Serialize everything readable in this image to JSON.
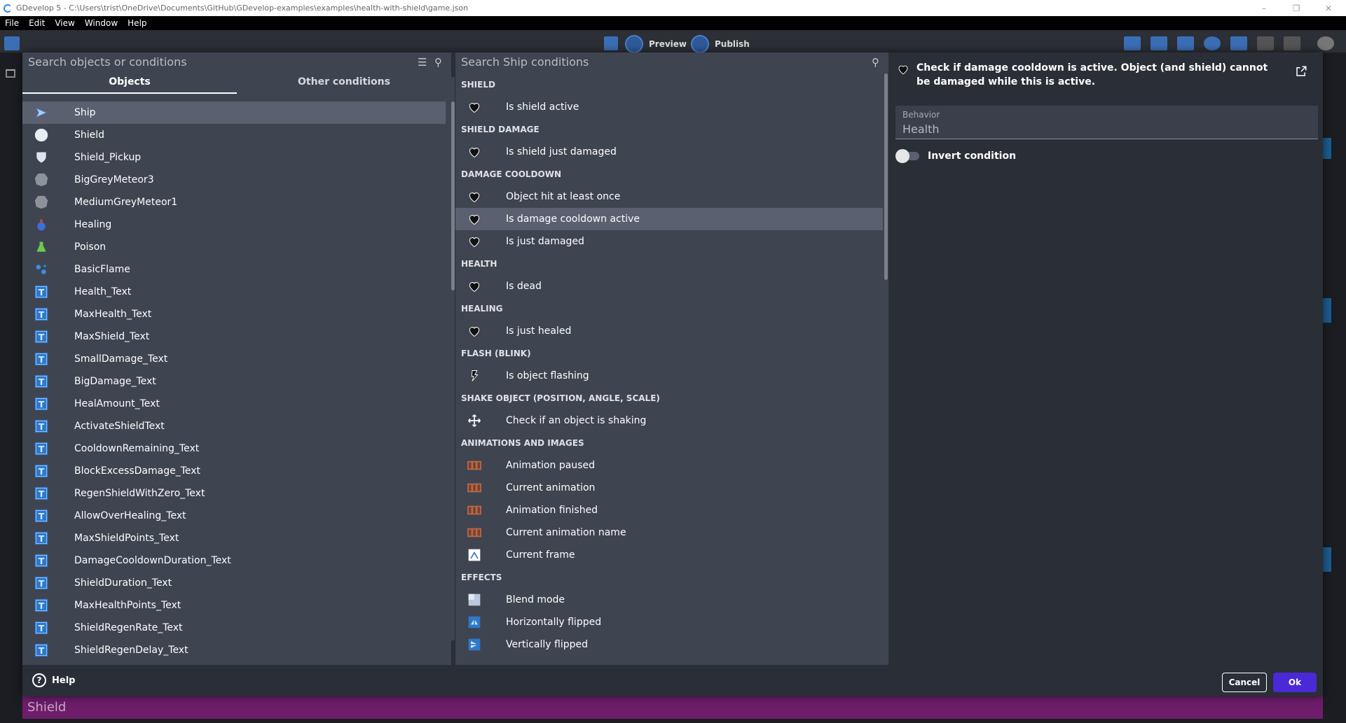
{
  "window": {
    "title": "GDevelop 5 - C:\\Users\\trist\\OneDrive\\Documents\\GitHub\\GDevelop-examples\\examples\\health-with-shield\\game.json",
    "controls": [
      "–",
      "❐",
      "✕"
    ]
  },
  "menubar": [
    "File",
    "Edit",
    "View",
    "Window",
    "Help"
  ],
  "toolbar": {
    "preview": "Preview",
    "publish": "Publish"
  },
  "objects_panel": {
    "search_placeholder": "Search objects or conditions",
    "tabs": [
      "Objects",
      "Other conditions"
    ],
    "selected": "Ship",
    "items": [
      {
        "name": "Ship",
        "icon": "ship-icon"
      },
      {
        "name": "Shield",
        "icon": "circle-icon"
      },
      {
        "name": "Shield_Pickup",
        "icon": "shield-icon"
      },
      {
        "name": "BigGreyMeteor3",
        "icon": "meteor-icon"
      },
      {
        "name": "MediumGreyMeteor1",
        "icon": "meteor-icon"
      },
      {
        "name": "Healing",
        "icon": "potion-blue-icon"
      },
      {
        "name": "Poison",
        "icon": "potion-green-icon"
      },
      {
        "name": "BasicFlame",
        "icon": "particles-icon"
      },
      {
        "name": "Health_Text",
        "icon": "text-object-icon"
      },
      {
        "name": "MaxHealth_Text",
        "icon": "text-object-icon"
      },
      {
        "name": "MaxShield_Text",
        "icon": "text-object-icon"
      },
      {
        "name": "SmallDamage_Text",
        "icon": "text-object-icon"
      },
      {
        "name": "BigDamage_Text",
        "icon": "text-object-icon"
      },
      {
        "name": "HealAmount_Text",
        "icon": "text-object-icon"
      },
      {
        "name": "ActivateShieldText",
        "icon": "text-object-icon"
      },
      {
        "name": "CooldownRemaining_Text",
        "icon": "text-object-icon"
      },
      {
        "name": "BlockExcessDamage_Text",
        "icon": "text-object-icon"
      },
      {
        "name": "RegenShieldWithZero_Text",
        "icon": "text-object-icon"
      },
      {
        "name": "AllowOverHealing_Text",
        "icon": "text-object-icon"
      },
      {
        "name": "MaxShieldPoints_Text",
        "icon": "text-object-icon"
      },
      {
        "name": "DamageCooldownDuration_Text",
        "icon": "text-object-icon"
      },
      {
        "name": "ShieldDuration_Text",
        "icon": "text-object-icon"
      },
      {
        "name": "MaxHealthPoints_Text",
        "icon": "text-object-icon"
      },
      {
        "name": "ShieldRegenRate_Text",
        "icon": "text-object-icon"
      },
      {
        "name": "ShieldRegenDelay_Text",
        "icon": "text-object-icon"
      }
    ]
  },
  "conditions_panel": {
    "search_placeholder": "Search Ship conditions",
    "selected": "Is damage cooldown active",
    "sections": [
      {
        "title": "SHIELD",
        "items": [
          {
            "label": "Is shield active",
            "icon": "heart-icon"
          }
        ]
      },
      {
        "title": "SHIELD DAMAGE",
        "items": [
          {
            "label": "Is shield just damaged",
            "icon": "heart-icon"
          }
        ]
      },
      {
        "title": "DAMAGE COOLDOWN",
        "items": [
          {
            "label": "Object hit at least once",
            "icon": "heart-icon"
          },
          {
            "label": "Is damage cooldown active",
            "icon": "heart-icon"
          },
          {
            "label": "Is just damaged",
            "icon": "heart-icon"
          }
        ]
      },
      {
        "title": "HEALTH",
        "items": [
          {
            "label": "Is dead",
            "icon": "heart-icon"
          }
        ]
      },
      {
        "title": "HEALING",
        "items": [
          {
            "label": "Is just healed",
            "icon": "heart-icon"
          }
        ]
      },
      {
        "title": "FLASH (BLINK)",
        "items": [
          {
            "label": "Is object flashing",
            "icon": "flash-icon"
          }
        ]
      },
      {
        "title": "SHAKE OBJECT (POSITION, ANGLE, SCALE)",
        "items": [
          {
            "label": "Check if an object is shaking",
            "icon": "move-arrows-icon"
          }
        ]
      },
      {
        "title": "ANIMATIONS AND IMAGES",
        "items": [
          {
            "label": "Animation paused",
            "icon": "film-icon"
          },
          {
            "label": "Current animation",
            "icon": "film-icon"
          },
          {
            "label": "Animation finished",
            "icon": "film-icon"
          },
          {
            "label": "Current animation name",
            "icon": "film-icon"
          },
          {
            "label": "Current frame",
            "icon": "frame-icon"
          }
        ]
      },
      {
        "title": "EFFECTS",
        "items": [
          {
            "label": "Blend mode",
            "icon": "blend-icon"
          },
          {
            "label": "Horizontally flipped",
            "icon": "flip-h-icon"
          },
          {
            "label": "Vertically flipped",
            "icon": "flip-v-icon"
          }
        ]
      }
    ]
  },
  "details_panel": {
    "description": "Check if damage cooldown is active. Object (and shield) cannot be damaged while this is active.",
    "behavior_label": "Behavior",
    "behavior_value": "Health",
    "invert_label": "Invert condition"
  },
  "footer": {
    "help": "Help",
    "cancel": "Cancel",
    "ok": "Ok"
  },
  "bottom_bar_text": "Shield",
  "colors": {
    "panel_bg": "#3f4451",
    "dialog_bg": "#2a2e36",
    "selected_row": "#5b6070",
    "ok_button": "#4a29d6",
    "bottom_bar": "#6e1d6b"
  }
}
